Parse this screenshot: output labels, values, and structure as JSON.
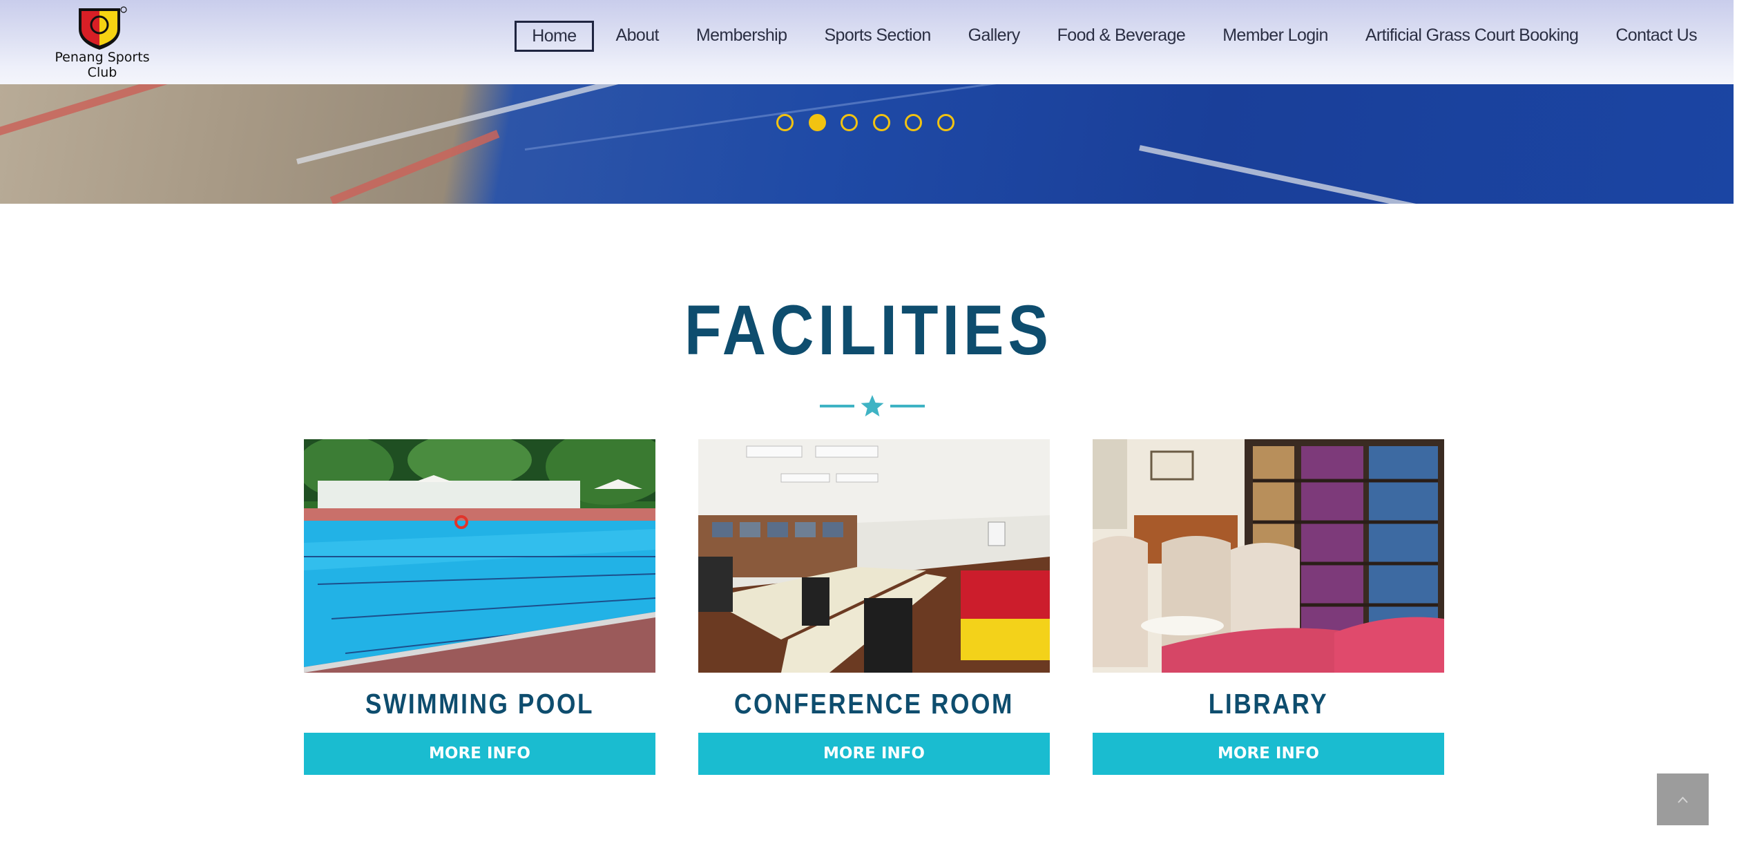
{
  "header": {
    "logo_text": "Penang Sports Club",
    "nav": [
      {
        "label": "Home",
        "active": true
      },
      {
        "label": "About"
      },
      {
        "label": "Membership"
      },
      {
        "label": "Sports Section"
      },
      {
        "label": "Gallery"
      },
      {
        "label": "Food & Beverage"
      },
      {
        "label": "Member Login"
      },
      {
        "label": "Artificial Grass Court Booking"
      },
      {
        "label": "Contact Us"
      }
    ]
  },
  "slider": {
    "count": 6,
    "active_index": 1,
    "dot_color": "#f2c311"
  },
  "facilities": {
    "title": "FACILITIES",
    "divider_icon": "star-icon",
    "cards": [
      {
        "name": "SWIMMING POOL",
        "button": "MORE INFO"
      },
      {
        "name": "CONFERENCE ROOM",
        "button": "MORE INFO"
      },
      {
        "name": "LIBRARY",
        "button": "MORE INFO"
      }
    ]
  },
  "back_to_top": {
    "icon": "chevron-up-icon"
  },
  "colors": {
    "title": "#0e4d6e",
    "accent": "#1abcd0",
    "divider": "#3fb3c4",
    "back_to_top": "#9c9c9c"
  }
}
